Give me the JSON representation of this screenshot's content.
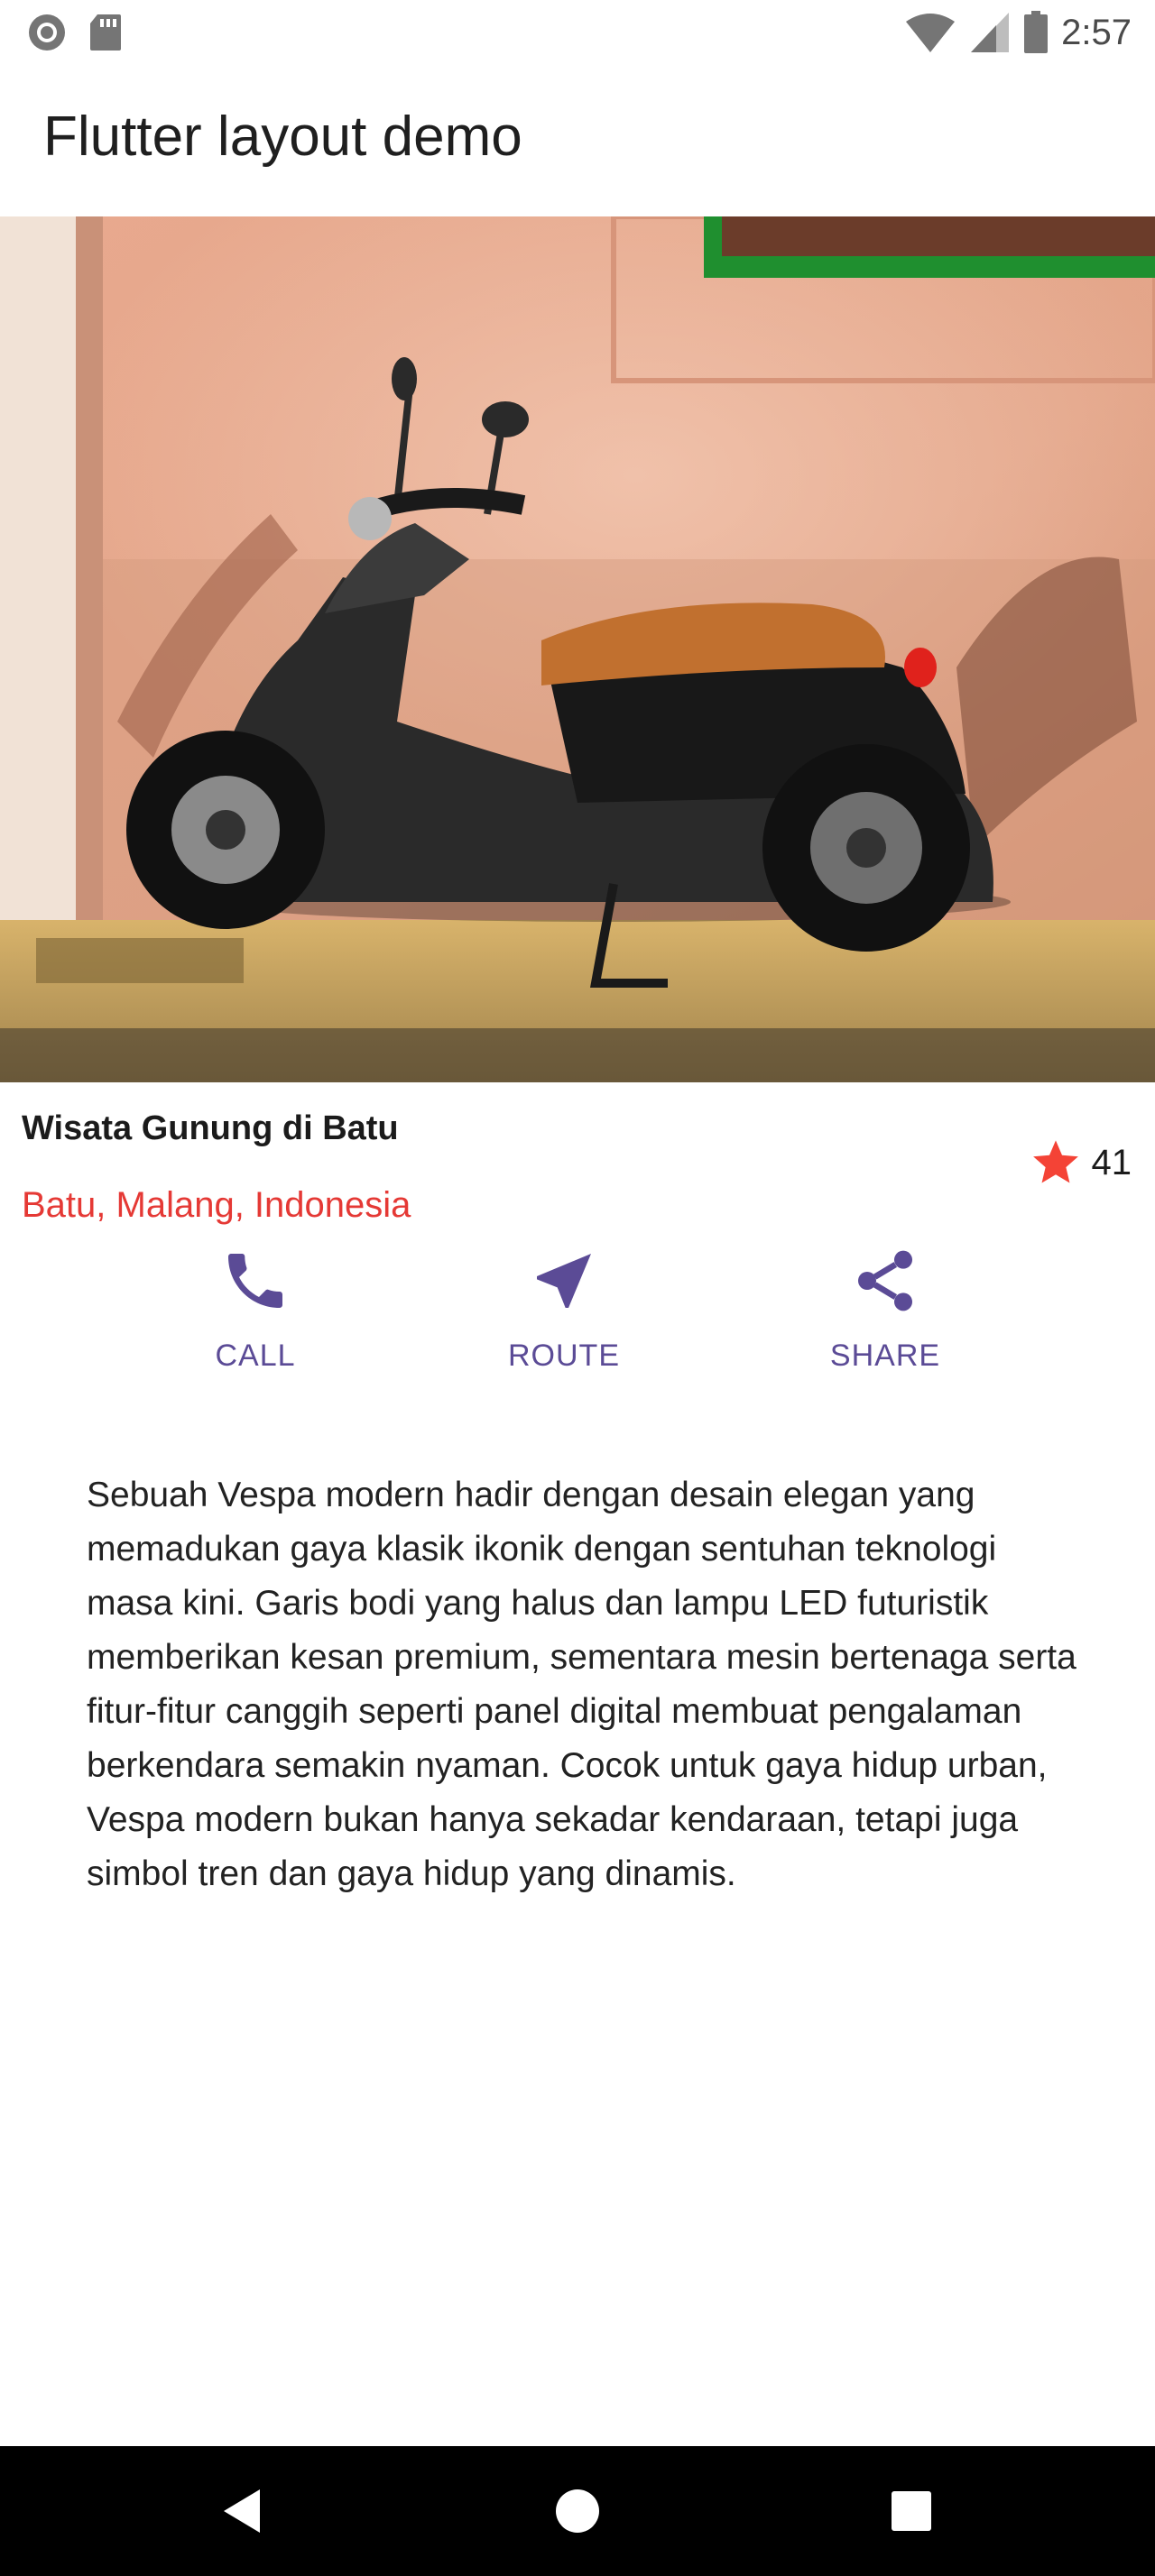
{
  "status_bar": {
    "time": "2:57",
    "icons": [
      "record-icon",
      "sd-card-icon",
      "wifi-icon",
      "signal-icon",
      "battery-icon"
    ]
  },
  "app_bar": {
    "title": "Flutter layout demo"
  },
  "place": {
    "name": "Wisata Gunung di Batu",
    "location": "Batu, Malang, Indonesia",
    "rating_count": "41"
  },
  "actions": [
    {
      "label": "CALL",
      "icon": "phone-icon"
    },
    {
      "label": "ROUTE",
      "icon": "navigation-icon"
    },
    {
      "label": "SHARE",
      "icon": "share-icon"
    }
  ],
  "description": "Sebuah Vespa modern hadir dengan desain elegan yang memadukan gaya klasik ikonik dengan sentuhan teknologi masa kini. Garis bodi yang halus dan lampu LED futuristik memberikan kesan premium, sementara mesin bertenaga serta fitur-fitur canggih seperti panel digital membuat pengalaman berkendara semakin nyaman. Cocok untuk gaya hidup urban, Vespa modern bukan hanya sekadar kendaraan, tetapi juga simbol tren dan gaya hidup yang dinamis.",
  "colors": {
    "accent": "#5b4b96",
    "location": "#e53935",
    "star": "#f44336",
    "nav_bar": "#000000"
  },
  "nav_bar": {
    "icons": [
      "back-icon",
      "home-icon",
      "recents-icon"
    ]
  }
}
